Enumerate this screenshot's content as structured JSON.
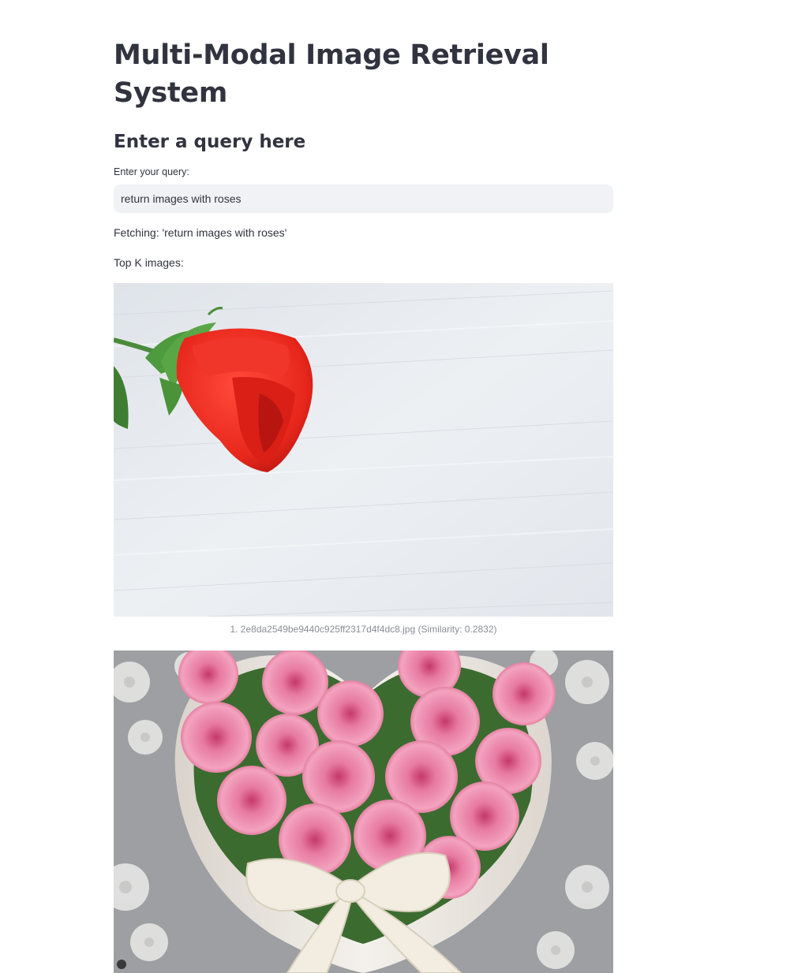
{
  "page": {
    "title": "Multi-Modal Image Retrieval System",
    "subheader": "Enter a query here"
  },
  "query": {
    "label": "Enter your query:",
    "value": "return images with roses"
  },
  "status": {
    "fetching": "Fetching: 'return images with roses'",
    "top_k_label": "Top K images:"
  },
  "results": [
    {
      "caption": "1. 2e8da2549be9440c925ff2317d4f4dc8.jpg (Similarity: 0.2832)",
      "image": "single-red-rose-on-white-wood"
    },
    {
      "caption": "",
      "image": "heart-box-of-pink-roses"
    }
  ],
  "colors": {
    "text": "#31333f",
    "input_bg": "#f0f2f6",
    "caption": "#8a8d97"
  }
}
